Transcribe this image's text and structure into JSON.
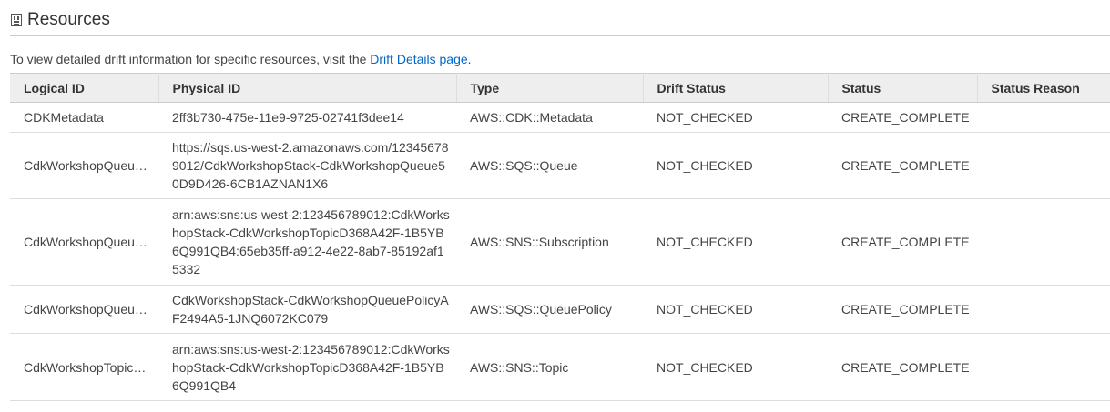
{
  "section": {
    "title": "Resources",
    "collapse_icon": "collapse-toggle-icon"
  },
  "intro": {
    "text": "To view detailed drift information for specific resources, visit the ",
    "link": "Drift Details page",
    "suffix": "."
  },
  "table": {
    "columns": [
      "Logical ID",
      "Physical ID",
      "Type",
      "Drift Status",
      "Status",
      "Status Reason"
    ],
    "rows": [
      {
        "logical_id": "CDKMetadata",
        "physical_id": "2ff3b730-475e-11e9-9725-02741f3dee14",
        "type": "AWS::CDK::Metadata",
        "drift_status": "NOT_CHECKED",
        "status": "CREATE_COMPLETE",
        "status_reason": ""
      },
      {
        "logical_id": "CdkWorkshopQueu…",
        "physical_id": "https://sqs.us-west-2.amazonaws.com/123456789012/CdkWorkshopStack-CdkWorkshopQueue50D9D426-6CB1AZNAN1X6",
        "type": "AWS::SQS::Queue",
        "drift_status": "NOT_CHECKED",
        "status": "CREATE_COMPLETE",
        "status_reason": ""
      },
      {
        "logical_id": "CdkWorkshopQueu…",
        "physical_id": "arn:aws:sns:us-west-2:123456789012:CdkWorkshopStack-CdkWorkshopTopicD368A42F-1B5YB6Q991QB4:65eb35ff-a912-4e22-8ab7-85192af15332",
        "type": "AWS::SNS::Subscription",
        "drift_status": "NOT_CHECKED",
        "status": "CREATE_COMPLETE",
        "status_reason": ""
      },
      {
        "logical_id": "CdkWorkshopQueu…",
        "physical_id": "CdkWorkshopStack-CdkWorkshopQueuePolicyAF2494A5-1JNQ6072KC079",
        "type": "AWS::SQS::QueuePolicy",
        "drift_status": "NOT_CHECKED",
        "status": "CREATE_COMPLETE",
        "status_reason": ""
      },
      {
        "logical_id": "CdkWorkshopTopic…",
        "physical_id": "arn:aws:sns:us-west-2:123456789012:CdkWorkshopStack-CdkWorkshopTopicD368A42F-1B5YB6Q991QB4",
        "type": "AWS::SNS::Topic",
        "drift_status": "NOT_CHECKED",
        "status": "CREATE_COMPLETE",
        "status_reason": ""
      }
    ]
  },
  "colors": {
    "link": "#0066cc",
    "status_complete": "#1d9a3b",
    "header_bg": "#eeeeee"
  }
}
